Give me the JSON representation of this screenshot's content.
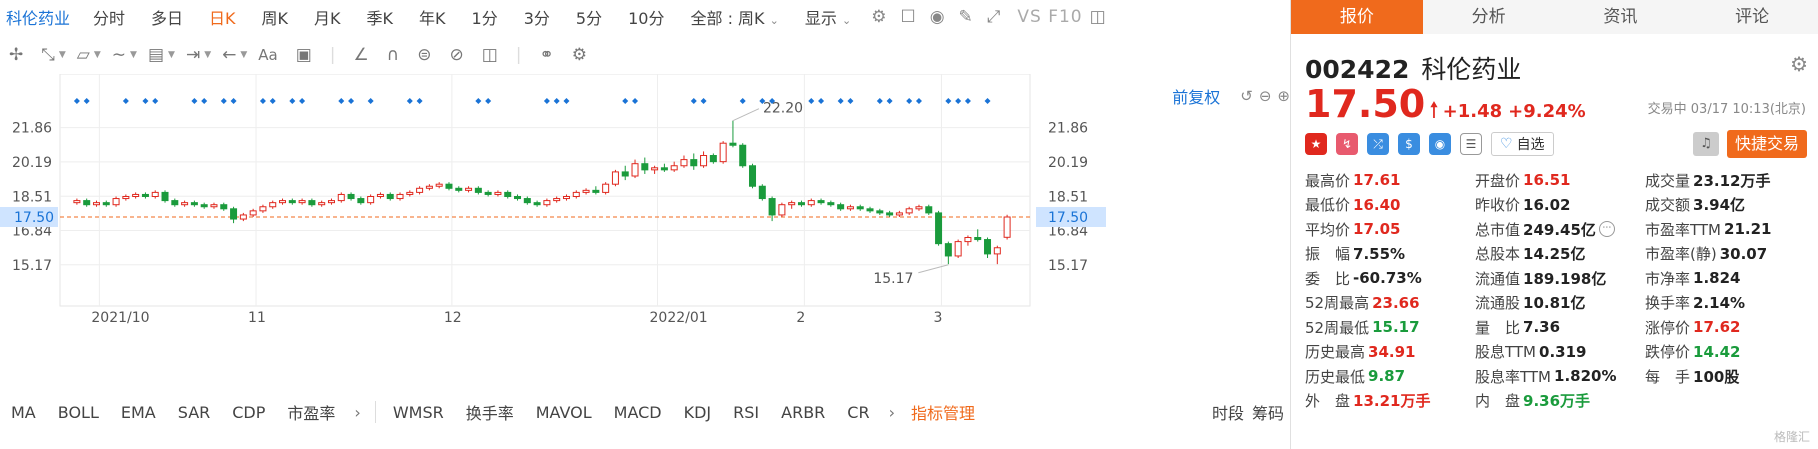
{
  "toolbar": {
    "stock_name": "科伦药业",
    "periods": [
      "分时",
      "多日",
      "日K",
      "周K",
      "月K",
      "季K",
      "年K",
      "1分",
      "3分",
      "5分",
      "10分"
    ],
    "active_period": "日K",
    "range_select": "全部 : 周K",
    "display_label": "显示",
    "vs_f10": "VS F10"
  },
  "chart_controls": {
    "restore_label": "前复权"
  },
  "chart_data": {
    "type": "candlestick",
    "x_tick_labels": [
      "2021/10",
      "11",
      "12",
      "2022/01",
      "2",
      "3"
    ],
    "y_tick_labels": [
      "21.86",
      "20.19",
      "18.51",
      "16.84",
      "15.17"
    ],
    "y_ticks": [
      21.86,
      20.19,
      18.51,
      16.84,
      15.17
    ],
    "ylim": [
      13.5,
      23.5
    ],
    "current_price_label": "17.50",
    "current_price": 17.5,
    "annotations": [
      {
        "text": "22.20",
        "value": 22.2
      },
      {
        "text": "15.17",
        "value": 15.17
      }
    ],
    "grid": true,
    "colors": {
      "up": "#e0281e",
      "down": "#1a9b3c",
      "marker": "#1a73d6"
    },
    "candles": [
      [
        18.2,
        18.4,
        18.1,
        18.3
      ],
      [
        18.3,
        18.4,
        18.0,
        18.1
      ],
      [
        18.1,
        18.3,
        18.0,
        18.2
      ],
      [
        18.2,
        18.3,
        18.0,
        18.1
      ],
      [
        18.1,
        18.5,
        18.0,
        18.4
      ],
      [
        18.4,
        18.6,
        18.3,
        18.5
      ],
      [
        18.5,
        18.7,
        18.4,
        18.6
      ],
      [
        18.6,
        18.7,
        18.4,
        18.5
      ],
      [
        18.5,
        18.8,
        18.4,
        18.7
      ],
      [
        18.7,
        18.8,
        18.2,
        18.3
      ],
      [
        18.3,
        18.4,
        18.0,
        18.1
      ],
      [
        18.1,
        18.3,
        18.0,
        18.2
      ],
      [
        18.2,
        18.3,
        18.0,
        18.1
      ],
      [
        18.1,
        18.2,
        17.9,
        18.0
      ],
      [
        18.0,
        18.2,
        17.9,
        18.1
      ],
      [
        18.1,
        18.2,
        17.8,
        17.9
      ],
      [
        17.9,
        18.0,
        17.2,
        17.4
      ],
      [
        17.4,
        17.7,
        17.3,
        17.6
      ],
      [
        17.6,
        17.9,
        17.5,
        17.8
      ],
      [
        17.8,
        18.1,
        17.7,
        18.0
      ],
      [
        18.0,
        18.3,
        17.9,
        18.2
      ],
      [
        18.2,
        18.4,
        18.1,
        18.3
      ],
      [
        18.3,
        18.4,
        18.1,
        18.2
      ],
      [
        18.2,
        18.4,
        18.1,
        18.3
      ],
      [
        18.3,
        18.4,
        18.0,
        18.1
      ],
      [
        18.1,
        18.3,
        18.0,
        18.2
      ],
      [
        18.2,
        18.4,
        18.1,
        18.3
      ],
      [
        18.3,
        18.7,
        18.2,
        18.6
      ],
      [
        18.6,
        18.7,
        18.3,
        18.4
      ],
      [
        18.4,
        18.5,
        18.1,
        18.2
      ],
      [
        18.2,
        18.6,
        18.1,
        18.5
      ],
      [
        18.5,
        18.7,
        18.4,
        18.6
      ],
      [
        18.6,
        18.7,
        18.3,
        18.4
      ],
      [
        18.4,
        18.7,
        18.3,
        18.6
      ],
      [
        18.6,
        18.8,
        18.5,
        18.7
      ],
      [
        18.7,
        19.0,
        18.6,
        18.9
      ],
      [
        18.9,
        19.1,
        18.8,
        19.0
      ],
      [
        19.0,
        19.2,
        18.9,
        19.1
      ],
      [
        19.1,
        19.2,
        18.8,
        18.9
      ],
      [
        18.9,
        19.0,
        18.7,
        18.8
      ],
      [
        18.8,
        19.0,
        18.7,
        18.9
      ],
      [
        18.9,
        19.0,
        18.6,
        18.7
      ],
      [
        18.7,
        18.8,
        18.5,
        18.6
      ],
      [
        18.6,
        18.8,
        18.5,
        18.7
      ],
      [
        18.7,
        18.8,
        18.4,
        18.5
      ],
      [
        18.5,
        18.6,
        18.3,
        18.4
      ],
      [
        18.4,
        18.5,
        18.1,
        18.2
      ],
      [
        18.2,
        18.3,
        18.0,
        18.1
      ],
      [
        18.1,
        18.4,
        18.0,
        18.3
      ],
      [
        18.3,
        18.5,
        18.2,
        18.4
      ],
      [
        18.4,
        18.6,
        18.3,
        18.5
      ],
      [
        18.5,
        18.8,
        18.4,
        18.7
      ],
      [
        18.7,
        18.9,
        18.6,
        18.8
      ],
      [
        18.8,
        19.0,
        18.6,
        18.7
      ],
      [
        18.7,
        19.2,
        18.6,
        19.1
      ],
      [
        19.1,
        19.8,
        19.0,
        19.7
      ],
      [
        19.7,
        20.0,
        19.3,
        19.5
      ],
      [
        19.5,
        20.3,
        19.4,
        20.1
      ],
      [
        20.1,
        20.4,
        19.6,
        19.8
      ],
      [
        19.8,
        20.0,
        19.6,
        19.9
      ],
      [
        19.9,
        20.1,
        19.7,
        19.8
      ],
      [
        19.8,
        20.2,
        19.7,
        20.0
      ],
      [
        20.0,
        20.5,
        19.9,
        20.3
      ],
      [
        20.3,
        20.6,
        19.8,
        20.0
      ],
      [
        20.0,
        20.7,
        19.9,
        20.5
      ],
      [
        20.5,
        20.6,
        20.1,
        20.2
      ],
      [
        20.2,
        21.2,
        20.1,
        21.1
      ],
      [
        21.1,
        22.2,
        20.9,
        21.0
      ],
      [
        21.0,
        21.1,
        19.9,
        20.0
      ],
      [
        20.0,
        20.1,
        18.9,
        19.0
      ],
      [
        19.0,
        19.1,
        18.3,
        18.4
      ],
      [
        18.4,
        18.5,
        17.3,
        17.6
      ],
      [
        17.6,
        18.2,
        17.5,
        18.1
      ],
      [
        18.1,
        18.3,
        17.9,
        18.2
      ],
      [
        18.2,
        18.3,
        18.0,
        18.1
      ],
      [
        18.1,
        18.4,
        18.0,
        18.3
      ],
      [
        18.3,
        18.4,
        18.1,
        18.2
      ],
      [
        18.2,
        18.3,
        18.0,
        18.1
      ],
      [
        18.1,
        18.2,
        17.8,
        17.9
      ],
      [
        17.9,
        18.1,
        17.8,
        18.0
      ],
      [
        18.0,
        18.1,
        17.8,
        17.9
      ],
      [
        17.9,
        18.0,
        17.7,
        17.8
      ],
      [
        17.8,
        17.9,
        17.6,
        17.7
      ],
      [
        17.7,
        17.8,
        17.5,
        17.6
      ],
      [
        17.6,
        17.8,
        17.5,
        17.7
      ],
      [
        17.7,
        18.0,
        17.6,
        17.9
      ],
      [
        17.9,
        18.1,
        17.8,
        18.0
      ],
      [
        18.0,
        18.1,
        17.6,
        17.7
      ],
      [
        17.7,
        17.8,
        16.1,
        16.2
      ],
      [
        16.2,
        16.3,
        15.2,
        15.6
      ],
      [
        15.6,
        16.4,
        15.5,
        16.3
      ],
      [
        16.3,
        16.6,
        16.1,
        16.5
      ],
      [
        16.5,
        16.9,
        16.3,
        16.4
      ],
      [
        16.4,
        16.5,
        15.5,
        15.7
      ],
      [
        15.7,
        16.1,
        15.2,
        16.0
      ],
      [
        16.51,
        17.61,
        16.4,
        17.5
      ]
    ]
  },
  "indicators": {
    "list": [
      "MA",
      "BOLL",
      "EMA",
      "SAR",
      "CDP",
      "市盈率"
    ],
    "list2": [
      "WMSR",
      "换手率",
      "MAVOL",
      "MACD",
      "KDJ",
      "RSI",
      "ARBR",
      "CR"
    ],
    "manage_label": "指标管理",
    "right_tabs": [
      "时段",
      "筹码"
    ]
  },
  "panel": {
    "tabs": [
      "报价",
      "分析",
      "资讯",
      "评论"
    ],
    "active_tab": "报价",
    "code": "002422",
    "name": "科伦药业",
    "price": "17.50",
    "change": "+1.48",
    "change_pct": "+9.24%",
    "trade_time": "交易中 03/17 10:13(北京)",
    "watch_label": "自选",
    "quick_trade_label": "快捷交易",
    "icons": [
      "flag-cn-icon",
      "hk-connect-icon",
      "cross-icon",
      "dollar-icon",
      "tag-icon",
      "note-icon"
    ],
    "stats": [
      [
        {
          "k": "最高价",
          "v": "17.61",
          "c": "red"
        },
        {
          "k": "开盘价",
          "v": "16.51",
          "c": "red"
        },
        {
          "k": "成交量",
          "v": "23.12万手",
          "c": "black"
        }
      ],
      [
        {
          "k": "最低价",
          "v": "16.40",
          "c": "red"
        },
        {
          "k": "昨收价",
          "v": "16.02",
          "c": "black"
        },
        {
          "k": "成交额",
          "v": "3.94亿",
          "c": "black"
        }
      ],
      [
        {
          "k": "平均价",
          "v": "17.05",
          "c": "red"
        },
        {
          "k": "总市值",
          "v": "249.45亿",
          "c": "black",
          "more": true
        },
        {
          "k": "市盈率TTM",
          "v": "21.21",
          "c": "black"
        }
      ],
      [
        {
          "k": "振　幅",
          "v": "7.55%",
          "c": "black"
        },
        {
          "k": "总股本",
          "v": "14.25亿",
          "c": "black"
        },
        {
          "k": "市盈率(静)",
          "v": "30.07",
          "c": "black"
        }
      ],
      [
        {
          "k": "委　比",
          "v": "-60.73%",
          "c": "black"
        },
        {
          "k": "流通值",
          "v": "189.198亿",
          "c": "black"
        },
        {
          "k": "市净率",
          "v": "1.824",
          "c": "black"
        }
      ],
      [
        {
          "k": "52周最高",
          "v": "23.66",
          "c": "red"
        },
        {
          "k": "流通股",
          "v": "10.81亿",
          "c": "black"
        },
        {
          "k": "换手率",
          "v": "2.14%",
          "c": "black"
        }
      ],
      [
        {
          "k": "52周最低",
          "v": "15.17",
          "c": "green"
        },
        {
          "k": "量　比",
          "v": "7.36",
          "c": "black"
        },
        {
          "k": "涨停价",
          "v": "17.62",
          "c": "red"
        }
      ],
      [
        {
          "k": "历史最高",
          "v": "34.91",
          "c": "red"
        },
        {
          "k": "股息TTM",
          "v": "0.319",
          "c": "black"
        },
        {
          "k": "跌停价",
          "v": "14.42",
          "c": "green"
        }
      ],
      [
        {
          "k": "历史最低",
          "v": "9.87",
          "c": "green"
        },
        {
          "k": "股息率TTM",
          "v": "1.820%",
          "c": "black"
        },
        {
          "k": "每　手",
          "v": "100股",
          "c": "black"
        }
      ],
      [
        {
          "k": "外　盘",
          "v": "13.21万手",
          "c": "red"
        },
        {
          "k": "内　盘",
          "v": "9.36万手",
          "c": "green"
        }
      ]
    ],
    "watermark": "格隆汇"
  }
}
